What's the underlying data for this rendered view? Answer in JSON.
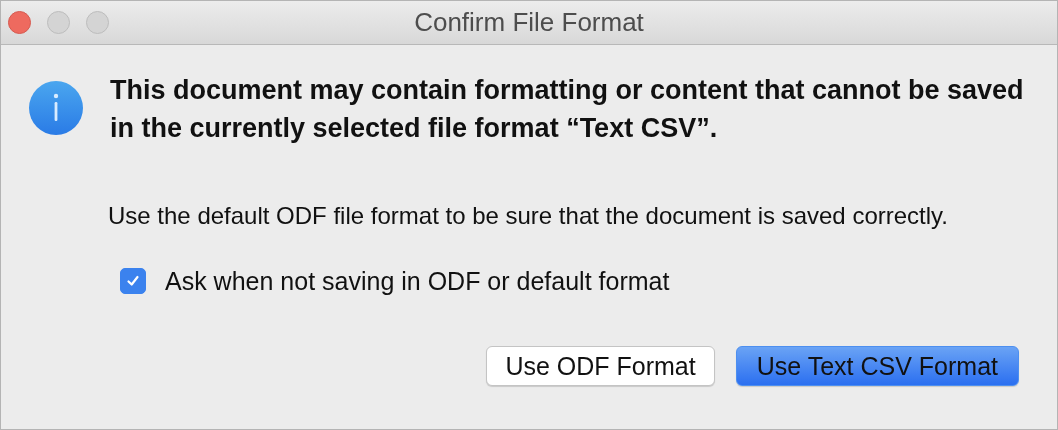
{
  "window": {
    "title": "Confirm File Format"
  },
  "message": {
    "heading": "This document may contain formatting or content that cannot be saved in the currently selected file format “Text CSV”.",
    "body": "Use the default ODF file format to be sure that the document is saved correctly."
  },
  "checkbox": {
    "label": "Ask when not saving in ODF or default format",
    "checked": true
  },
  "buttons": [
    {
      "label": "Use ODF Format",
      "default": false
    },
    {
      "label": "Use Text CSV Format",
      "default": true
    }
  ]
}
